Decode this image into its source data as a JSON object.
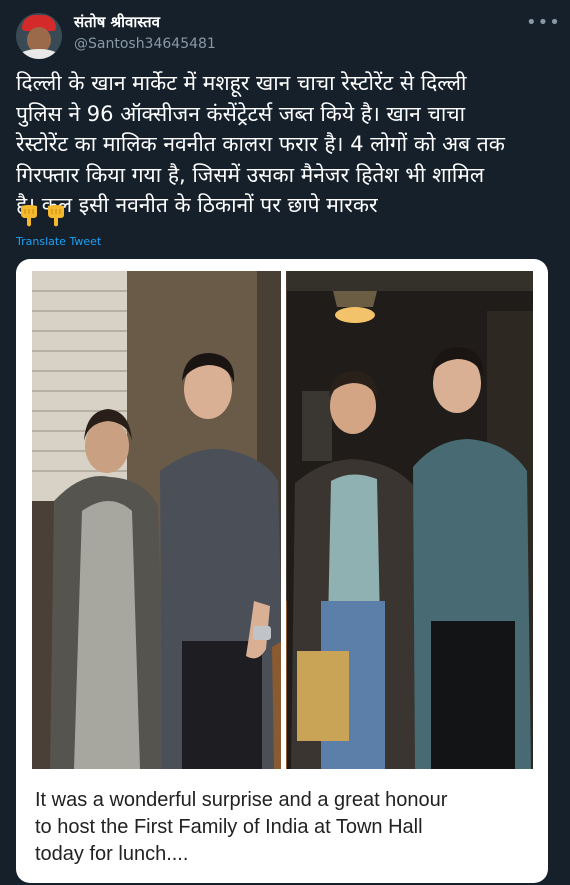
{
  "author": {
    "name": "संतोष श्रीवास्तव",
    "handle": "@Santosh34645481"
  },
  "tweet": {
    "lines": [
      "दिल्ली के खान मार्केट में मशहूर खान चाचा रेस्टोरेंट से दिल्ली",
      "पुलिस ने 96 ऑक्सीजन कंसेंट्रेटर्स जब्त किये है। खान चाचा",
      "रेस्टोरेंट का मालिक नवनीत कालरा फरार है। 4 लोगों को अब तक",
      "गिरफ्तार किया गया है, जिसमें उसका मैनेजर हितेश भी शामिल",
      "है। कल इसी नवनीत के ठिकानों पर छापे मारकर"
    ],
    "emojis": [
      "pointing-down-hand-icon",
      "pointing-down-hand-icon"
    ],
    "translate_label": "Translate Tweet"
  },
  "media": {
    "caption_lines": [
      "It was a wonderful surprise and a great honour",
      "to host the First Family of India at Town Hall",
      "today for lunch...."
    ]
  },
  "colors": {
    "background": "#15202b",
    "secondary_text": "#8899a6",
    "link": "#1da1f2"
  }
}
